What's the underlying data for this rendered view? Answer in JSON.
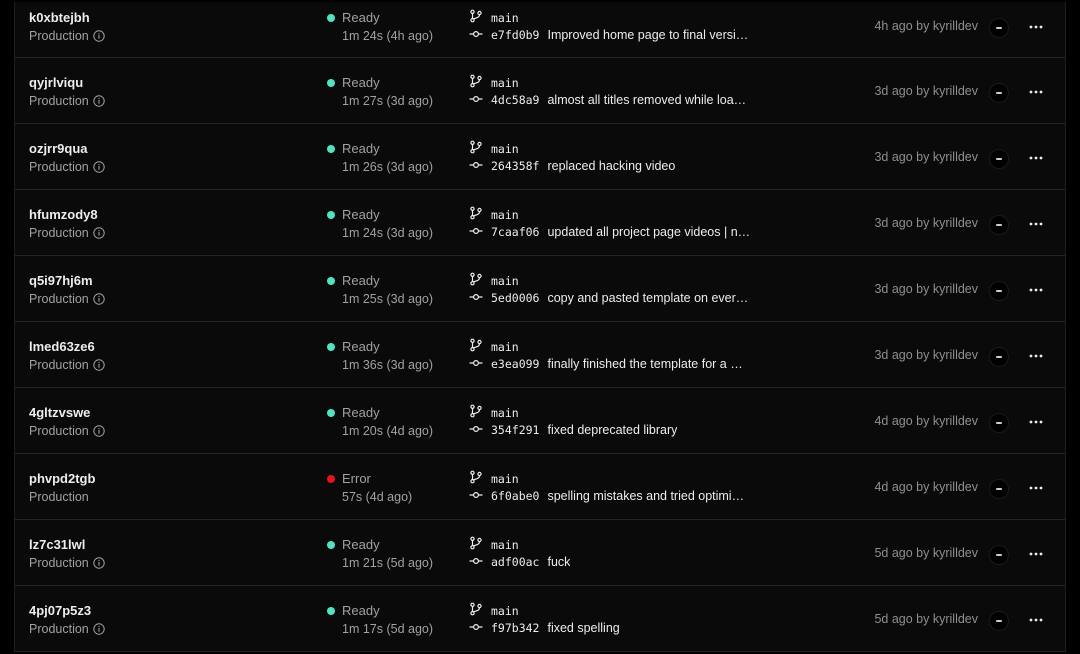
{
  "colors": {
    "ready": "#50e3c2",
    "error": "#e5141a"
  },
  "deployments": [
    {
      "id": "k0xbtejbh",
      "env": "Production",
      "info": true,
      "status": "Ready",
      "status_type": "ready",
      "duration": "1m 24s (4h ago)",
      "branch": "main",
      "hash": "e7fd0b9",
      "message": "Improved home page to final versi…",
      "meta": "4h ago by kyrilldev"
    },
    {
      "id": "qyjrlviqu",
      "env": "Production",
      "info": true,
      "status": "Ready",
      "status_type": "ready",
      "duration": "1m 27s (3d ago)",
      "branch": "main",
      "hash": "4dc58a9",
      "message": "almost all titles removed while loa…",
      "meta": "3d ago by kyrilldev"
    },
    {
      "id": "ozjrr9qua",
      "env": "Production",
      "info": true,
      "status": "Ready",
      "status_type": "ready",
      "duration": "1m 26s (3d ago)",
      "branch": "main",
      "hash": "264358f",
      "message": "replaced hacking video",
      "meta": "3d ago by kyrilldev"
    },
    {
      "id": "hfumzody8",
      "env": "Production",
      "info": true,
      "status": "Ready",
      "status_type": "ready",
      "duration": "1m 24s (3d ago)",
      "branch": "main",
      "hash": "7caaf06",
      "message": "updated all project page videos | n…",
      "meta": "3d ago by kyrilldev"
    },
    {
      "id": "q5i97hj6m",
      "env": "Production",
      "info": true,
      "status": "Ready",
      "status_type": "ready",
      "duration": "1m 25s (3d ago)",
      "branch": "main",
      "hash": "5ed0006",
      "message": "copy and pasted template on ever…",
      "meta": "3d ago by kyrilldev"
    },
    {
      "id": "lmed63ze6",
      "env": "Production",
      "info": true,
      "status": "Ready",
      "status_type": "ready",
      "duration": "1m 36s (3d ago)",
      "branch": "main",
      "hash": "e3ea099",
      "message": "finally finished the template for a …",
      "meta": "3d ago by kyrilldev"
    },
    {
      "id": "4gltzvswe",
      "env": "Production",
      "info": true,
      "status": "Ready",
      "status_type": "ready",
      "duration": "1m 20s (4d ago)",
      "branch": "main",
      "hash": "354f291",
      "message": "fixed deprecated library",
      "meta": "4d ago by kyrilldev"
    },
    {
      "id": "phvpd2tgb",
      "env": "Production",
      "info": false,
      "status": "Error",
      "status_type": "error",
      "duration": "57s (4d ago)",
      "branch": "main",
      "hash": "6f0abe0",
      "message": "spelling mistakes and tried optimi…",
      "meta": "4d ago by kyrilldev"
    },
    {
      "id": "lz7c31lwl",
      "env": "Production",
      "info": true,
      "status": "Ready",
      "status_type": "ready",
      "duration": "1m 21s (5d ago)",
      "branch": "main",
      "hash": "adf00ac",
      "message": "fuck",
      "meta": "5d ago by kyrilldev"
    },
    {
      "id": "4pj07p5z3",
      "env": "Production",
      "info": true,
      "status": "Ready",
      "status_type": "ready",
      "duration": "1m 17s (5d ago)",
      "branch": "main",
      "hash": "f97b342",
      "message": "fixed spelling",
      "meta": "5d ago by kyrilldev"
    }
  ]
}
